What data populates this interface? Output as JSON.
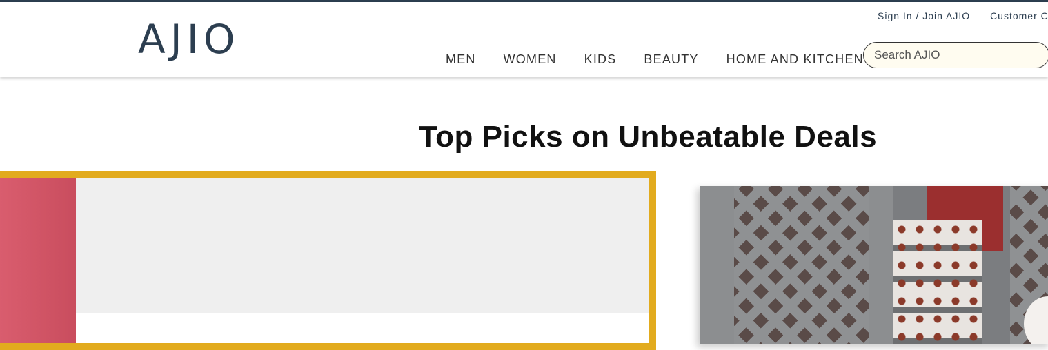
{
  "brand": {
    "logo": "AJIO"
  },
  "utility": {
    "sign_in": "Sign In / Join AJIO",
    "customer_care": "Customer Care"
  },
  "nav": {
    "items": [
      "MEN",
      "WOMEN",
      "KIDS",
      "BEAUTY",
      "HOME AND KITCHEN"
    ]
  },
  "search": {
    "placeholder": "Search AJIO",
    "value": ""
  },
  "main": {
    "headline": "Top Picks on Unbeatable Deals"
  },
  "colors": {
    "brand": "#2c3e50",
    "gold_border": "#e2ab1e",
    "pink_panel": "#d95d6e",
    "search_bg": "#fffcf0"
  }
}
